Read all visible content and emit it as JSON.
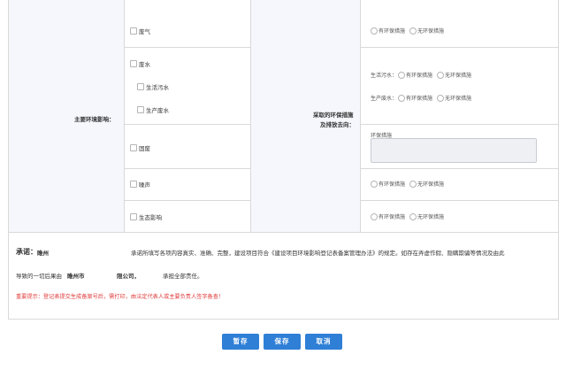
{
  "form": {
    "main_impact_label": "主要环境影响：",
    "measures_label_line1": "采取的环保措施",
    "measures_label_line2": "及排放去向：",
    "impacts": {
      "waste_gas": "废气",
      "waste_water": "废水",
      "domestic_sewage": "生活污水",
      "production_wastewater": "生产废水",
      "solid_waste": "固废",
      "noise": "噪声",
      "ecology": "生态影响"
    },
    "options": {
      "has_measures": "有环保措施",
      "no_measures": "无环保措施"
    },
    "row_labels": {
      "domestic_sewage": "生活污水：",
      "production_wastewater": "生产废水："
    },
    "measures_textarea_label": "环保措施"
  },
  "promise": {
    "title": "承诺：",
    "company_prefix": "睢州",
    "text_line1": "承诺所填写各项内容真实、准确、完整，建设项目符合《建设项目环境影响登记表备案管理办法》的规定。如存在弄虚作假、隐瞒欺骗等情况及由此",
    "text_line2_prefix": "导致的一切后果由",
    "city": "睢州市",
    "company_suffix": "限公司，",
    "text_line2_suffix": "承担全部责任。",
    "warning": "重要提示：登记表提交生成备案号后，需打印，由法定代表人或主要负责人签字备查！"
  },
  "buttons": {
    "temp_save": "暂存",
    "save": "保存",
    "cancel": "取消"
  },
  "colors": {
    "button_bg": "#2f7fd6",
    "warning_text": "#e03c3c",
    "label_cell_bg": "#f5f7fc",
    "border": "#d9d9d9"
  }
}
